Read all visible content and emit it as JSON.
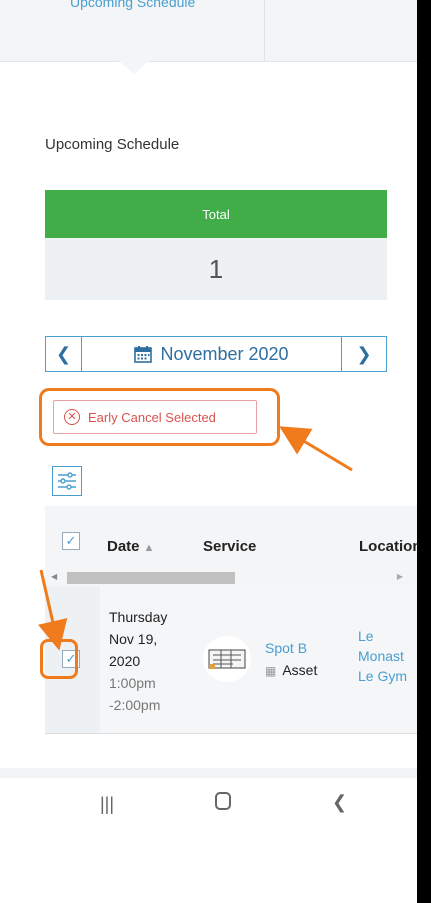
{
  "tabbar": {
    "tab1_label": "Upcoming Schedule"
  },
  "section_title": "Upcoming Schedule",
  "total": {
    "label": "Total",
    "value": "1"
  },
  "month_nav": {
    "month": "November 2020"
  },
  "early_cancel_label": "Early Cancel Selected",
  "table": {
    "columns": [
      "Date",
      "Service",
      "Location"
    ],
    "rows": [
      {
        "date_line1": "Thursday",
        "date_line2": "Nov 19,",
        "date_line3": "2020",
        "time_line1": "1:00pm",
        "time_line2": "-2:00pm",
        "service_name": "Spot B",
        "service_type": "Asset",
        "location_line1": "Le",
        "location_line2": "Monast",
        "location_line3": "Le Gym"
      }
    ]
  },
  "colors": {
    "accent_blue": "#4a9fd1",
    "total_green": "#41ad49",
    "cancel_red": "#d9534f",
    "annotation_orange": "#ef7b1d"
  }
}
